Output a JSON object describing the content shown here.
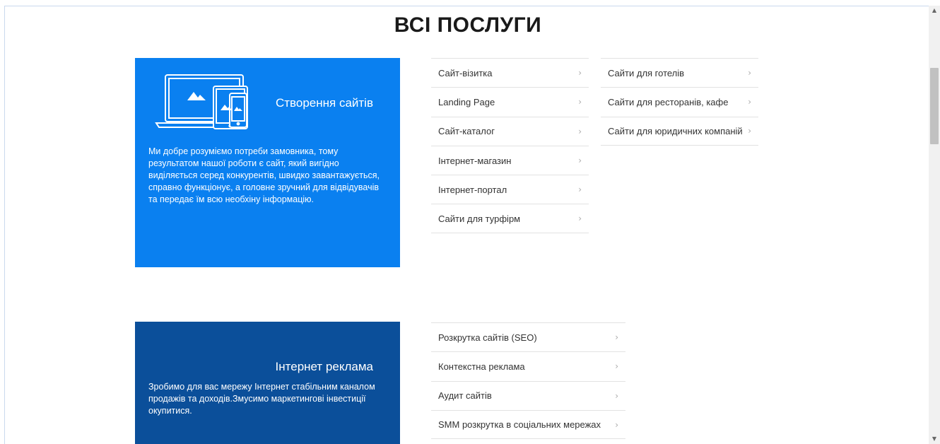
{
  "page": {
    "title": "ВСІ ПОСЛУГИ"
  },
  "sections": [
    {
      "title": "Створення сайтів",
      "description": "Ми добре розуміємо потреби замовника, тому результатом нашої роботи є сайт, який вигідно виділяється серед конкурентів, швидко завантажується, справно функціонує, а головне зручний для відвідувачів та передає їм всю необхіну інформацію.",
      "icon": "devices-icon",
      "color": "#0a80f0",
      "lists": [
        [
          "Сайт-візитка",
          "Landing Page",
          "Сайт-каталог",
          "Інтернет-магазин",
          "Інтернет-портал",
          "Сайти для турфірм"
        ],
        [
          "Сайти для готелів",
          "Сайти для ресторанів, кафе",
          "Сайти для юридичних компаній"
        ]
      ]
    },
    {
      "title": "Інтернет реклама",
      "description": "Зробимо для вас мережу Інтернет стабільним каналом продажів та доходів.Змусимо маркетингові інвестиції окупитися.",
      "color": "#0b4f9a",
      "lists": [
        [
          "Розкрутка сайтів (SEO)",
          "Контекстна реклама",
          "Аудит сайтів",
          "SMM розкрутка в соціальних мережах"
        ]
      ]
    }
  ],
  "chevron": "›",
  "scrollbar": {
    "up": "▲",
    "down": "▼"
  }
}
